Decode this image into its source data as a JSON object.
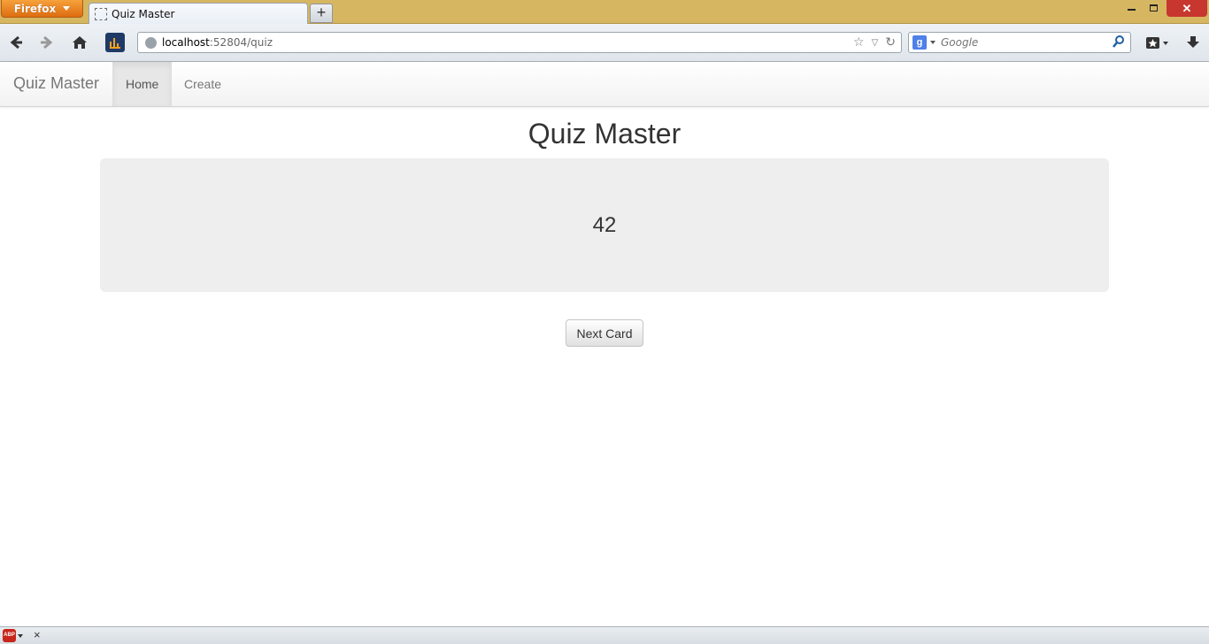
{
  "browser": {
    "menu_button_label": "Firefox",
    "tab_title": "Quiz Master",
    "new_tab_label": "+",
    "url_host": "localhost",
    "url_path": ":52804/quiz",
    "search_engine": "Google",
    "search_placeholder": "Google",
    "addon_bar": {
      "adblock_label": "ABP",
      "close_label": "×"
    }
  },
  "site": {
    "brand": "Quiz Master",
    "nav": [
      {
        "label": "Home",
        "active": true
      },
      {
        "label": "Create",
        "active": false
      }
    ]
  },
  "main": {
    "title": "Quiz Master",
    "card_value": "42",
    "next_button_label": "Next Card"
  },
  "colors": {
    "firefox_orange": "#e07c1a",
    "titlebar": "#d6b660",
    "card_bg": "#eeeeee",
    "close_red": "#c7372f"
  },
  "icons": [
    "back-arrow-icon",
    "forward-arrow-icon",
    "home-icon",
    "addon-chart-icon",
    "globe-icon",
    "star-icon",
    "dropdown-icon",
    "reload-icon",
    "google-icon",
    "magnifier-icon",
    "bookmarks-icon",
    "download-icon",
    "adblock-icon",
    "close-icon"
  ]
}
